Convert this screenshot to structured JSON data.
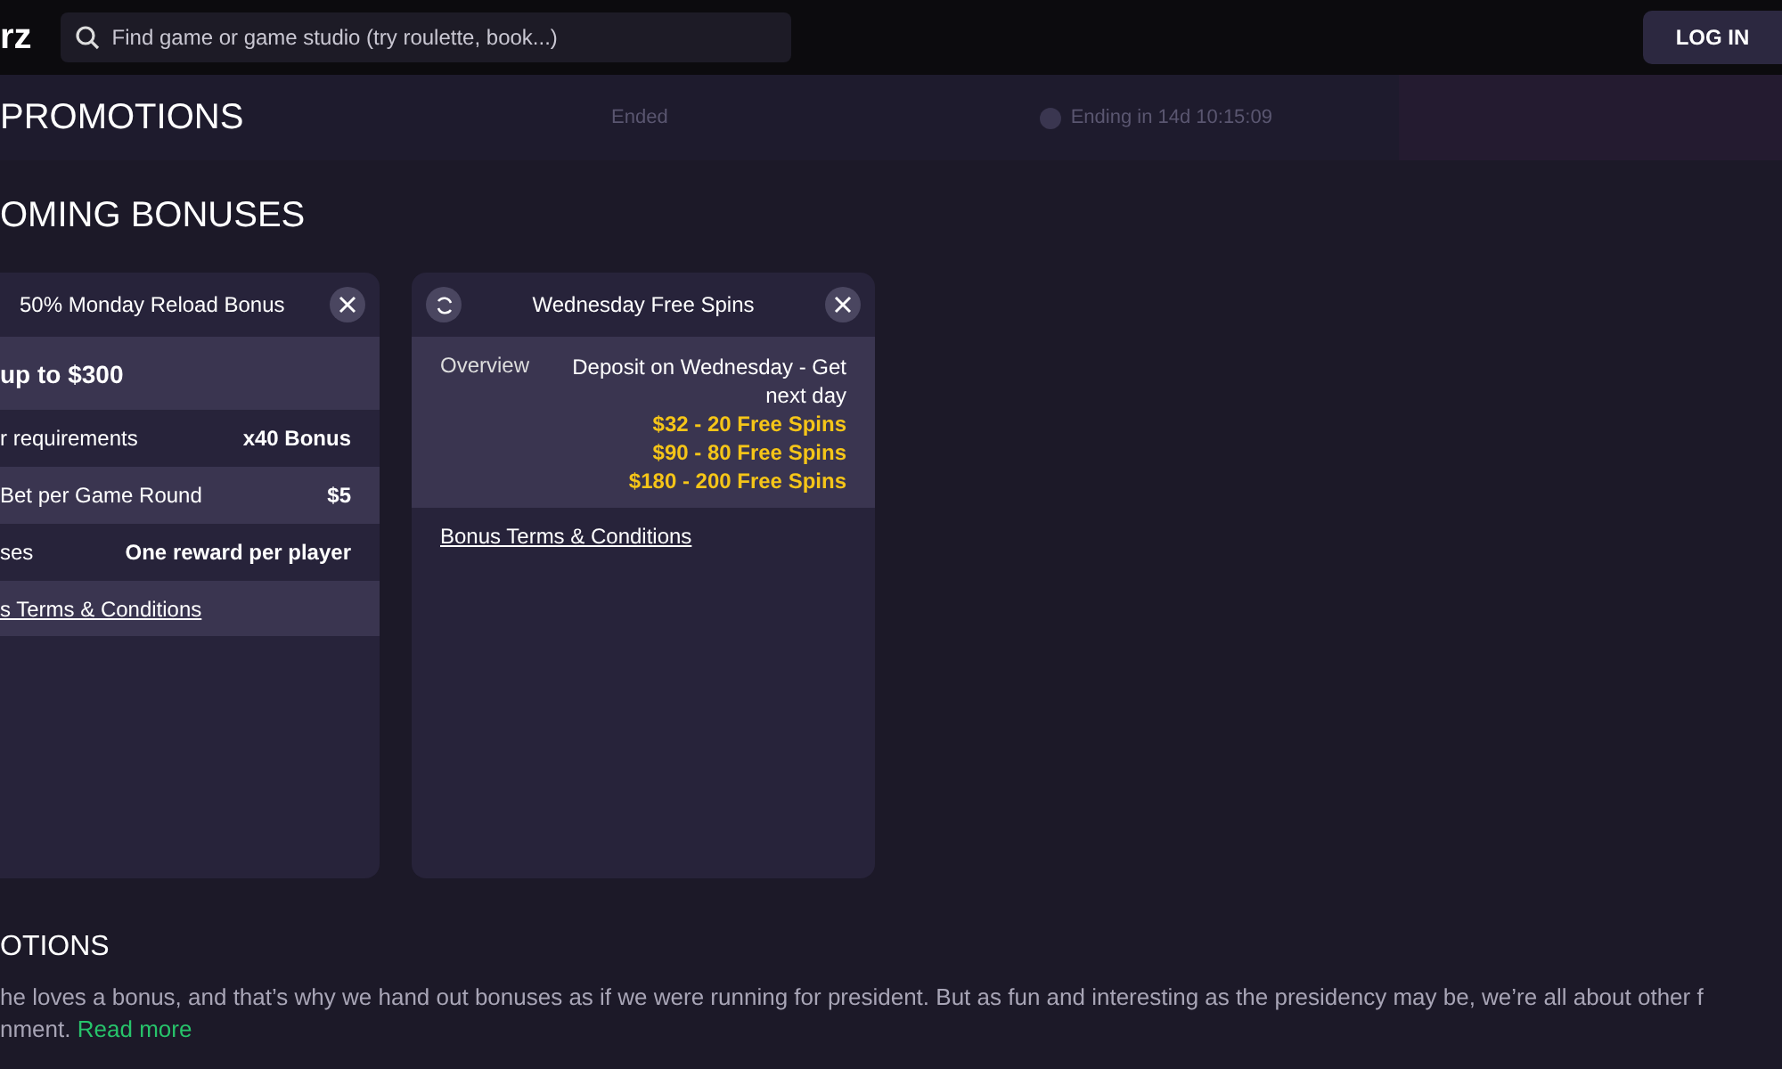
{
  "header": {
    "logo": "rz",
    "search": {
      "placeholder": "Find game or game studio (try roulette, book...)"
    },
    "login": "LOG IN"
  },
  "promo_strip": {
    "status": "Ended",
    "timer": "Ending in 14d 10:15:09"
  },
  "promotions_heading": "PROMOTIONS",
  "upcoming_heading": "OMING BONUSES",
  "cards": [
    {
      "title": "50% Monday Reload Bonus",
      "refresh": false,
      "headline": "up to $300",
      "rows": [
        {
          "label": "r requirements",
          "value": "x40 Bonus"
        },
        {
          "label": "Bet per Game Round",
          "value": "$5"
        },
        {
          "label": "ses",
          "value": "One reward per player"
        }
      ],
      "terms": "s Terms & Conditions"
    },
    {
      "title": "Wednesday Free Spins",
      "refresh": true,
      "overview": {
        "label": "Overview",
        "text": "Deposit on Wednesday - Get next day",
        "offers": [
          "$32 - 20 Free Spins",
          "$90 - 80 Free Spins",
          "$180 - 200 Free Spins"
        ]
      },
      "terms": "Bonus Terms & Conditions"
    }
  ],
  "about": {
    "heading": "OTIONS",
    "text": "he loves a bonus, and that’s why we hand out bonuses as if we were running for president. But as fun and interesting as the presidency may be, we’re all about other f\nnment.",
    "link": "Read more"
  }
}
